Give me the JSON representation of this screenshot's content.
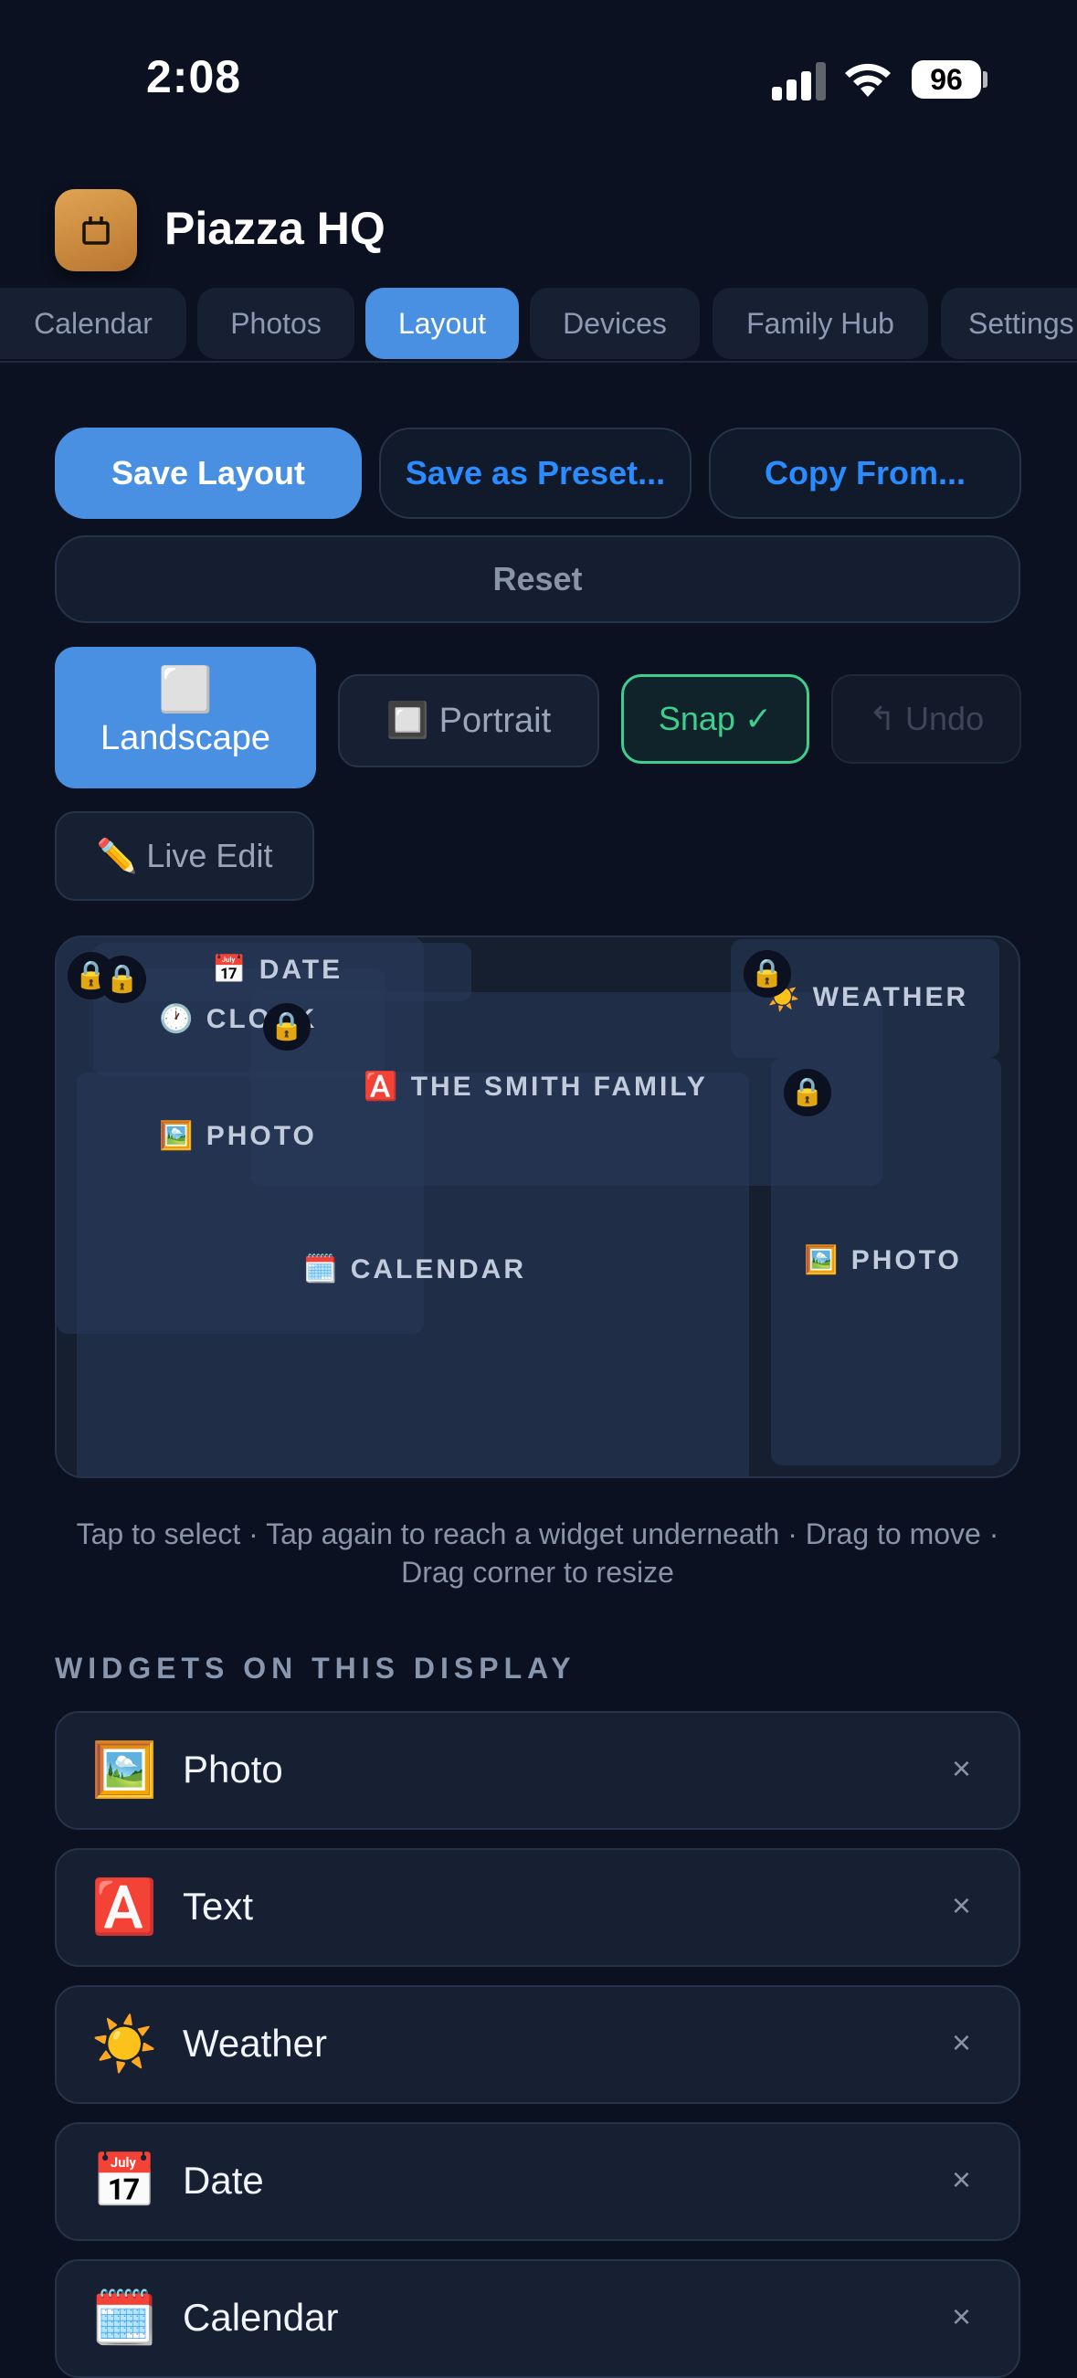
{
  "status": {
    "time": "2:08",
    "battery": "96"
  },
  "app": {
    "title": "Piazza HQ"
  },
  "tabs": [
    "Calendar",
    "Photos",
    "Layout",
    "Devices",
    "Family Hub",
    "Settings"
  ],
  "active_tab": "Layout",
  "actions": {
    "save_layout": "Save Layout",
    "save_preset": "Save as Preset...",
    "copy_from": "Copy From...",
    "reset": "Reset"
  },
  "orientation": {
    "landscape_icon": "⬜",
    "landscape": "Landscape",
    "portrait": "🔲 Portrait",
    "snap": "Snap ✓",
    "undo": "↰ Undo",
    "live_edit": "✏️ Live Edit"
  },
  "canvas": {
    "date_label": "📅 DATE",
    "clock_label": "🕐 CLOCK",
    "weather_label": "☀️ WEATHER",
    "text_label": "🅰️ THE SMITH FAMILY",
    "photo1_label": "🖼️ PHOTO",
    "calendar_label": "🗓️ CALENDAR",
    "photo2_label": "🖼️ PHOTO",
    "lock_icon": "🔒"
  },
  "hint": "Tap to select · Tap again to reach a widget underneath · Drag to move · Drag corner to resize",
  "section_title": "WIDGETS ON THIS DISPLAY",
  "widgets": [
    {
      "icon": "🖼️",
      "label": "Photo",
      "remove": "×"
    },
    {
      "icon": "🅰️",
      "label": "Text",
      "remove": "×"
    },
    {
      "icon": "☀️",
      "label": "Weather",
      "remove": "×"
    },
    {
      "icon": "📅",
      "label": "Date",
      "remove": "×"
    },
    {
      "icon": "🗓️",
      "label": "Calendar",
      "remove": "×"
    }
  ],
  "colors": {
    "accent": "#4a90e2",
    "snap_green": "#3ecf8e",
    "background": "#0b1120",
    "link_blue": "#2b8cff"
  }
}
